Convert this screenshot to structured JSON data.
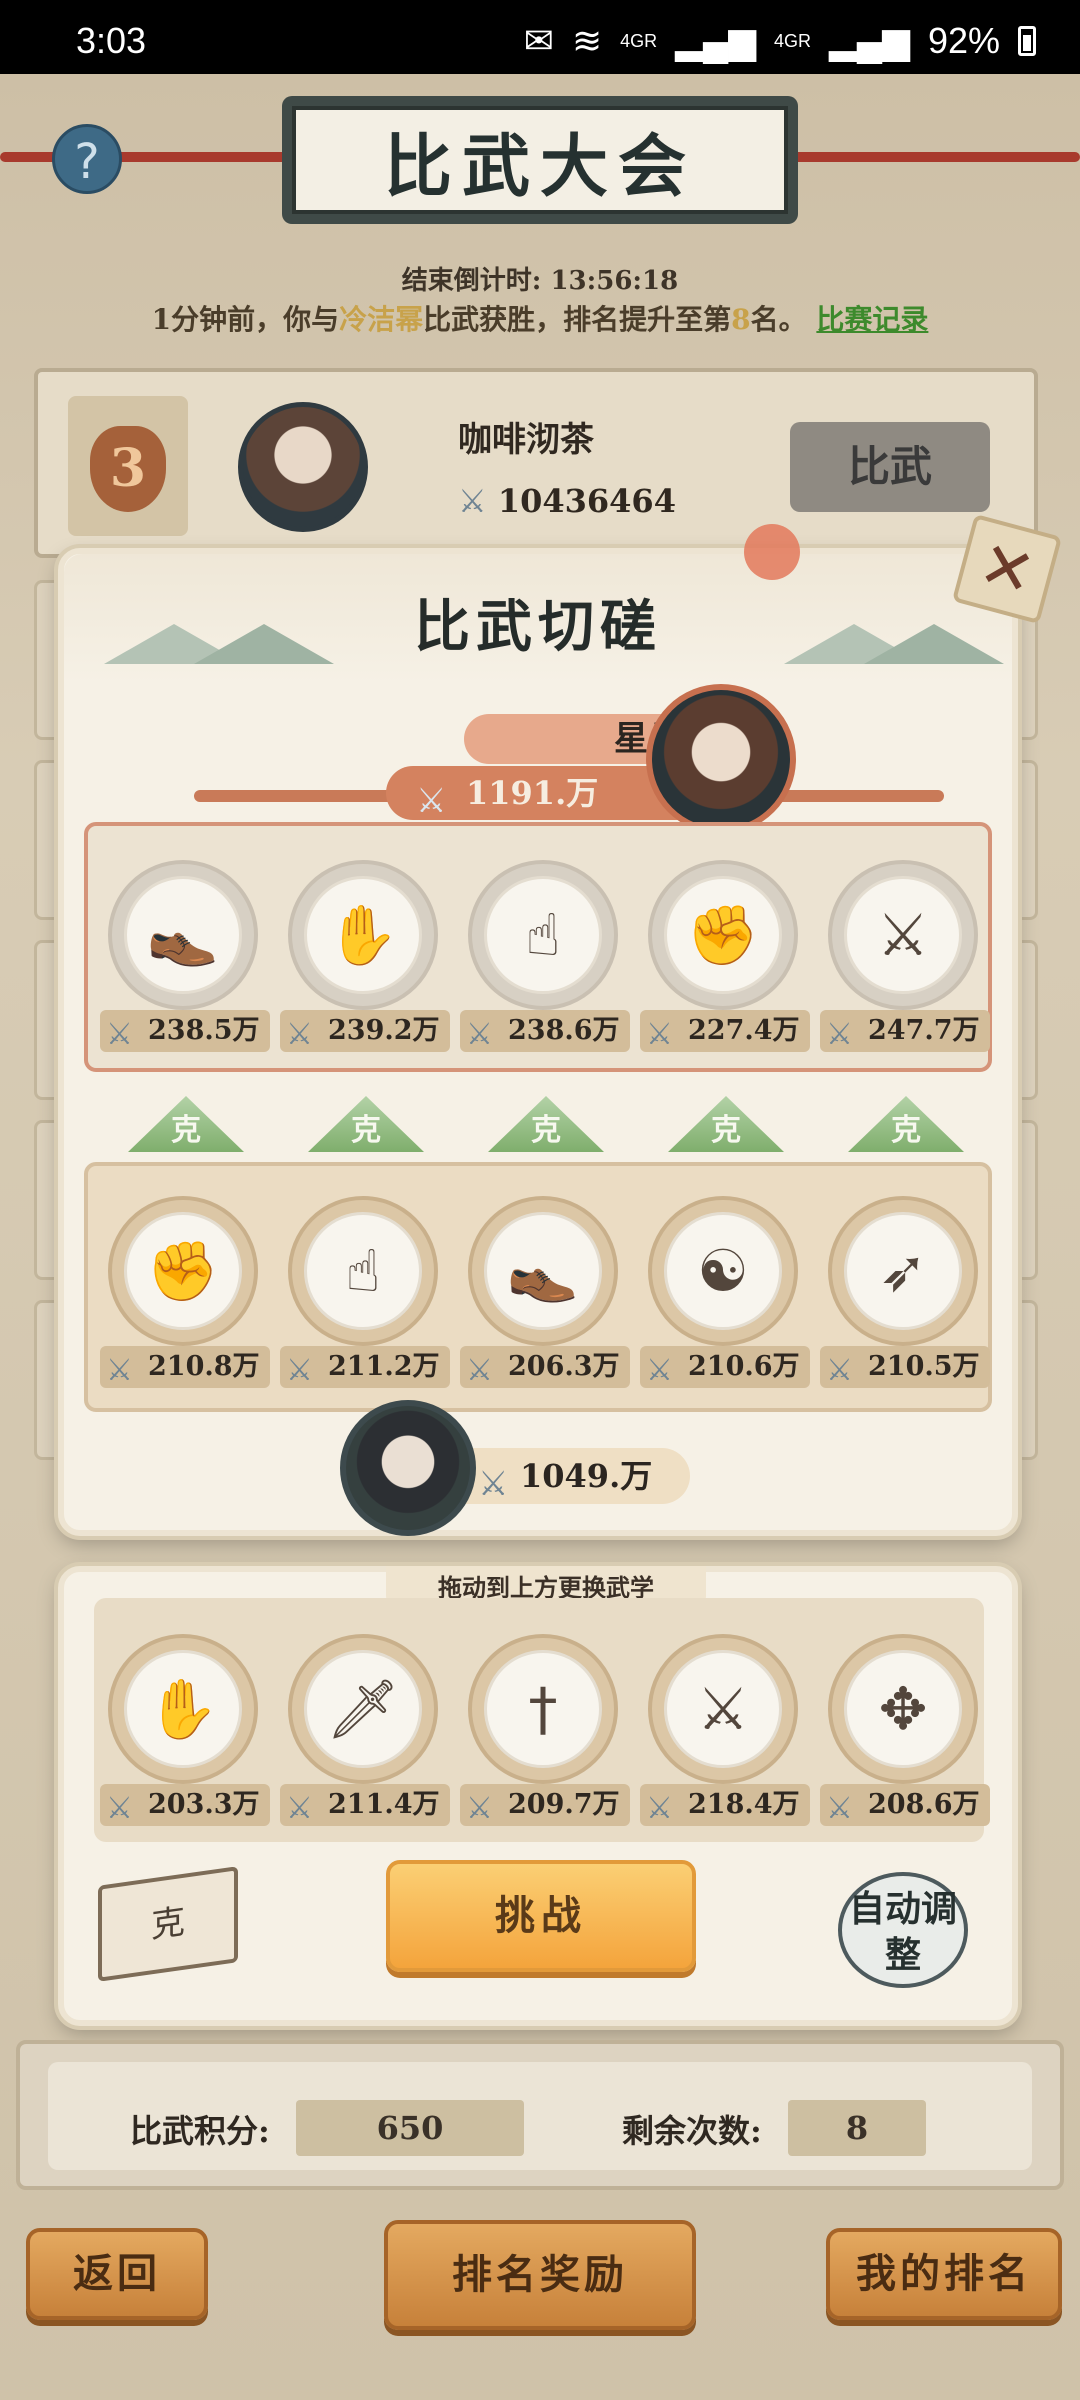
{
  "status_bar": {
    "time": "3:03",
    "network1": "4GR",
    "network2": "4GR",
    "battery": "92%"
  },
  "header": {
    "title": "比武大会",
    "help_label": "?"
  },
  "countdown": {
    "label": "结束倒计时:",
    "value": "13:56:18"
  },
  "notice": {
    "prefix": "1分钟前，你与",
    "opponent": "冷洁幂",
    "middle": "比武获胜，排名提升至第",
    "rank": "8",
    "suffix": "名。",
    "record_link": "比赛记录"
  },
  "rank_row": {
    "rank": "3",
    "name": "咖啡沏茶",
    "power": "10436464",
    "button": "比武"
  },
  "dialog": {
    "title": "比武切磋",
    "close": "✕",
    "opponent": {
      "name": "星月",
      "power": "1191.万",
      "skills": [
        {
          "icon": "shoe-icon",
          "glyph": "👞",
          "power": "238.5万"
        },
        {
          "icon": "palm-icon",
          "glyph": "✋",
          "power": "239.2万"
        },
        {
          "icon": "finger-icon",
          "glyph": "☝",
          "power": "238.6万"
        },
        {
          "icon": "fist-icon",
          "glyph": "✊",
          "power": "227.4万"
        },
        {
          "icon": "crossed-spears-icon",
          "glyph": "⚔",
          "power": "247.7万"
        }
      ]
    },
    "counter_label": "克",
    "self": {
      "power": "1049.万",
      "skills": [
        {
          "icon": "fist-icon",
          "glyph": "✊",
          "power": "210.8万"
        },
        {
          "icon": "finger-icon",
          "glyph": "☝",
          "power": "211.2万"
        },
        {
          "icon": "shoe-icon",
          "glyph": "👞",
          "power": "206.3万"
        },
        {
          "icon": "meditation-icon",
          "glyph": "☯",
          "power": "210.6万"
        },
        {
          "icon": "feather-icon",
          "glyph": "➶",
          "power": "210.5万"
        }
      ]
    }
  },
  "tray": {
    "hint": "拖动到上方更换武学",
    "skills": [
      {
        "icon": "palm-icon",
        "glyph": "✋",
        "power": "203.3万"
      },
      {
        "icon": "saber-icon",
        "glyph": "🗡",
        "power": "211.4万"
      },
      {
        "icon": "sword-icon",
        "glyph": "†",
        "power": "209.7万"
      },
      {
        "icon": "crossed-spears-icon",
        "glyph": "⚔",
        "power": "218.4万"
      },
      {
        "icon": "throwing-knives-icon",
        "glyph": "✥",
        "power": "208.6万"
      }
    ],
    "challenge_button": "挑战",
    "auto_button": "自动调整",
    "book_label": "克"
  },
  "stats": {
    "score_label": "比武积分:",
    "score_value": "650",
    "remaining_label": "剩余次数:",
    "remaining_value": "8"
  },
  "bottom_nav": {
    "back": "返回",
    "rank_reward": "排名奖励",
    "my_rank": "我的排名"
  },
  "colors": {
    "accent_orange": "#f4a43c",
    "counter_green": "#7fae6c",
    "opponent_red": "#d4825f"
  }
}
